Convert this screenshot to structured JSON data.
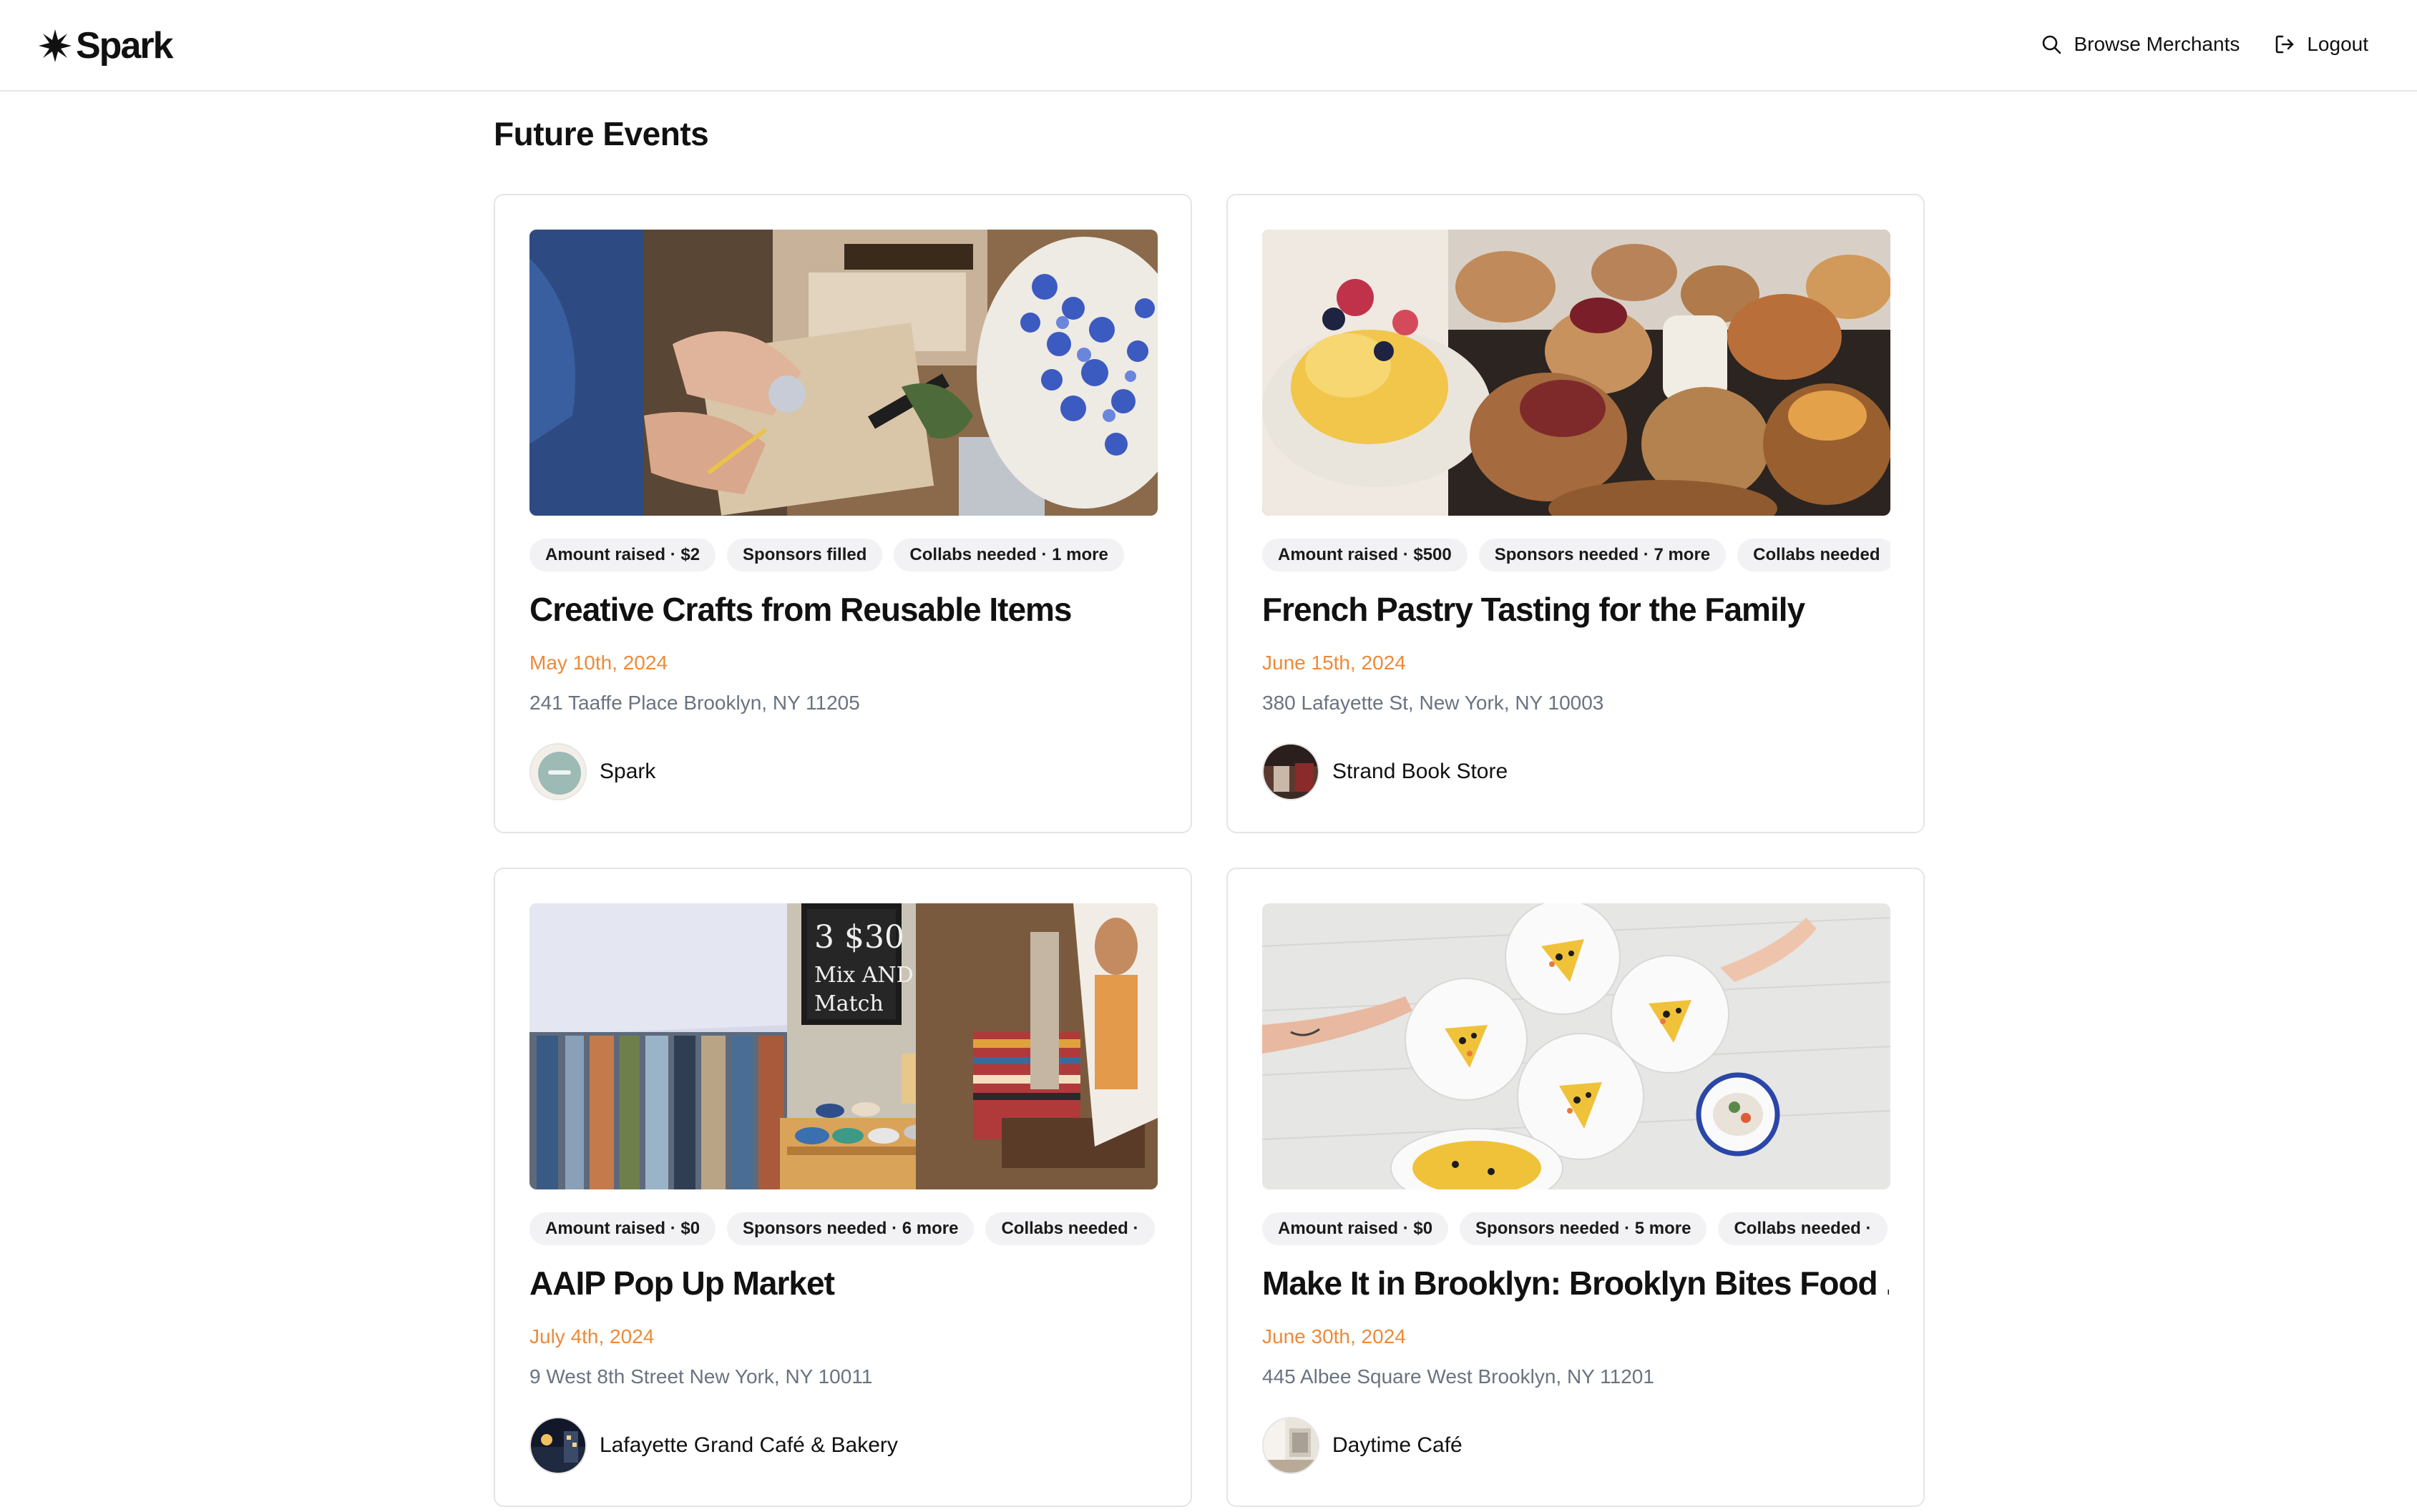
{
  "header": {
    "logo_text": "Spark",
    "logo_icon": "starburst-icon",
    "nav": {
      "browse_label": "Browse Merchants",
      "browse_icon": "search-icon",
      "logout_label": "Logout",
      "logout_icon": "logout-icon"
    }
  },
  "page": {
    "title": "Future Events"
  },
  "colors": {
    "date": "#ec8a3a",
    "address": "#6b7280",
    "chip_bg": "#f2f2f4",
    "card_border": "#e5e5e5"
  },
  "events": [
    {
      "chips": [
        "Amount raised · $2",
        "Sponsors filled",
        "Collabs needed · 1 more"
      ],
      "title": "Creative Crafts from Reusable Items",
      "date": "May 10th, 2024",
      "address": "241 Taaffe Place Brooklyn, NY 11205",
      "host": "Spark",
      "image": "crafts-photo"
    },
    {
      "chips": [
        "Amount raised · $500",
        "Sponsors needed · 7 more",
        "Collabs needed"
      ],
      "title": "French Pastry Tasting for the Family",
      "date": "June 15th, 2024",
      "address": "380 Lafayette St, New York, NY 10003",
      "host": "Strand Book Store",
      "image": "pastry-photo"
    },
    {
      "chips": [
        "Amount raised · $0",
        "Sponsors needed · 6 more",
        "Collabs needed ·"
      ],
      "title": "AAIP Pop Up Market",
      "date": "July 4th, 2024",
      "address": "9 West 8th Street New York, NY 10011",
      "host": "Lafayette Grand Café & Bakery",
      "image": "market-photo"
    },
    {
      "chips": [
        "Amount raised · $0",
        "Sponsors needed · 5 more",
        "Collabs needed ·"
      ],
      "title": "Make It in Brooklyn: Brooklyn Bites Food ...",
      "date": "June 30th, 2024",
      "address": "445 Albee Square West Brooklyn, NY 11201",
      "host": "Daytime Café",
      "image": "food-plates-photo"
    }
  ]
}
